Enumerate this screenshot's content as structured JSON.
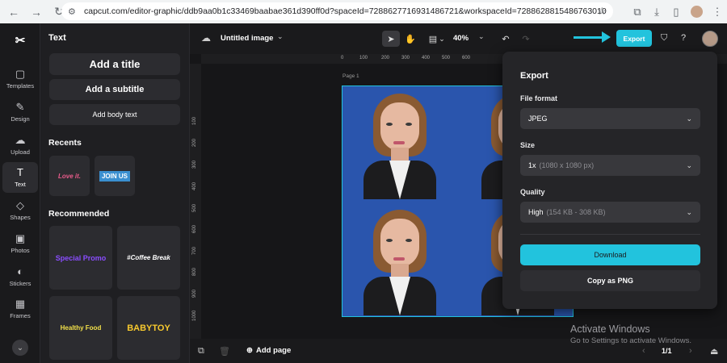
{
  "browser": {
    "url": "capcut.com/editor-graphic/ddb9aa0b1c33469baabae361d390ff0d?spaceId=7288627716931486721&workspaceId=7288628815486763010"
  },
  "rail": {
    "items": [
      {
        "label": "Templates",
        "icon": "templates-icon"
      },
      {
        "label": "Design",
        "icon": "design-icon"
      },
      {
        "label": "Upload",
        "icon": "upload-icon"
      },
      {
        "label": "Text",
        "icon": "text-icon"
      },
      {
        "label": "Shapes",
        "icon": "shapes-icon"
      },
      {
        "label": "Photos",
        "icon": "photos-icon"
      },
      {
        "label": "Stickers",
        "icon": "stickers-icon"
      },
      {
        "label": "Frames",
        "icon": "frames-icon"
      }
    ],
    "active": "Text"
  },
  "panel": {
    "title": "Text",
    "add_title": "Add a title",
    "add_subtitle": "Add a subtitle",
    "add_body": "Add body text",
    "recents_title": "Recents",
    "recents": [
      "Love it.",
      "JOIN US"
    ],
    "recommended_title": "Recommended",
    "recommended": [
      "Special Promo",
      "#Coffee Break",
      "Healthy Food",
      "BABYTOY"
    ]
  },
  "toolbar": {
    "doc_title": "Untitled image",
    "zoom": "40%",
    "export_label": "Export"
  },
  "canvas": {
    "page_label": "Page 1",
    "ruler_top": [
      "0",
      "100",
      "200",
      "300",
      "400",
      "500",
      "600"
    ],
    "ruler_left": [
      "100",
      "200",
      "300",
      "400",
      "500",
      "600",
      "700",
      "800",
      "900",
      "1000"
    ]
  },
  "bottombar": {
    "add_page": "Add page",
    "page_count": "1/1"
  },
  "export_panel": {
    "title": "Export",
    "file_format_label": "File format",
    "file_format_value": "JPEG",
    "size_label": "Size",
    "size_value": "1x",
    "size_detail": "(1080 x 1080 px)",
    "quality_label": "Quality",
    "quality_value": "High",
    "quality_detail": "(154 KB - 308 KB)",
    "download_label": "Download",
    "copy_label": "Copy as PNG"
  },
  "watermark": {
    "title": "Activate Windows",
    "subtitle": "Go to Settings to activate Windows."
  },
  "colors": {
    "accent": "#22c3dd",
    "canvas_bg": "#2a55ad"
  }
}
